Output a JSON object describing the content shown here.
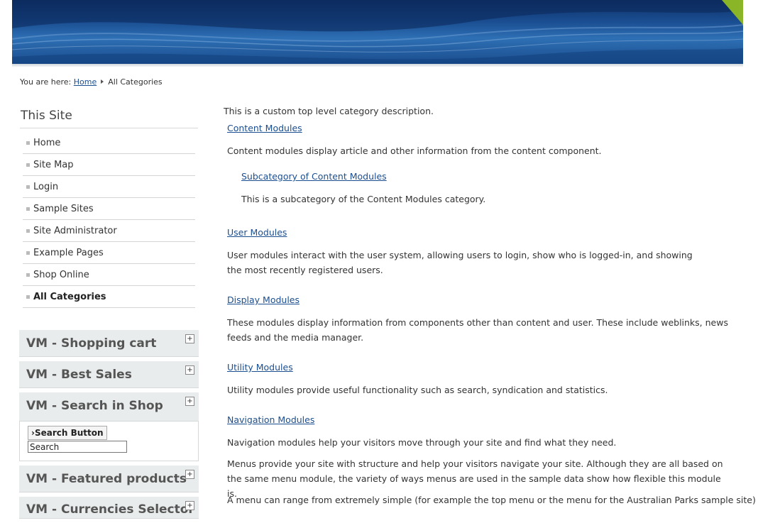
{
  "breadcrumb": {
    "prefix": "You are here:",
    "home": "Home",
    "current": "All Categories"
  },
  "sidebar": {
    "title": "This Site",
    "items": [
      {
        "label": "Home"
      },
      {
        "label": "Site Map"
      },
      {
        "label": "Login"
      },
      {
        "label": "Sample Sites"
      },
      {
        "label": "Site Administrator"
      },
      {
        "label": "Example Pages"
      },
      {
        "label": "Shop Online"
      },
      {
        "label": "All Categories",
        "active": true
      }
    ]
  },
  "modules": {
    "cart": {
      "title": "VM - Shopping cart",
      "toggle": "+"
    },
    "best": {
      "title": "VM - Best Sales",
      "toggle": "+"
    },
    "search": {
      "title": "VM - Search in Shop",
      "toggle": "+",
      "button": "Search Button",
      "input_value": "Search"
    },
    "featured": {
      "title": "VM - Featured products",
      "toggle": "+"
    },
    "currency": {
      "title": "VM - Currencies Selector",
      "toggle": "+"
    }
  },
  "main": {
    "intro": "This is a custom top level category description.",
    "categories": [
      {
        "link": "Content Modules",
        "desc": "Content modules display article and other information from the content component."
      },
      {
        "link": "Subcategory of Content Modules",
        "desc": "This is a subcategory of the Content Modules category."
      },
      {
        "link": "User Modules",
        "desc": "User modules interact with the user system, allowing users to login, show who is logged-in, and showing the most recently registered users."
      },
      {
        "link": "Display Modules",
        "desc": "These modules display information from components other than content and user. These include weblinks, news feeds and the media manager."
      },
      {
        "link": "Utility Modules",
        "desc": "Utility modules provide useful functionality such as search, syndication and statistics."
      },
      {
        "link": "Navigation Modules",
        "desc": "Navigation modules help your visitors move through your site and find what they need."
      }
    ],
    "menus_para": "Menus provide your site with structure and help your visitors navigate your site.  Although they are all based on the same menu module, the variety of ways menus are used in the sample data show how flexible this module is.",
    "menu_range_para": "A menu can range from extremely simple (for example the top menu or the menu for the Australian Parks sample site) to"
  },
  "colors": {
    "link": "#1b4e8f",
    "banner": "#1b4f93",
    "module_bg": "#e9ecec",
    "corner_accent": "#8ab526"
  }
}
